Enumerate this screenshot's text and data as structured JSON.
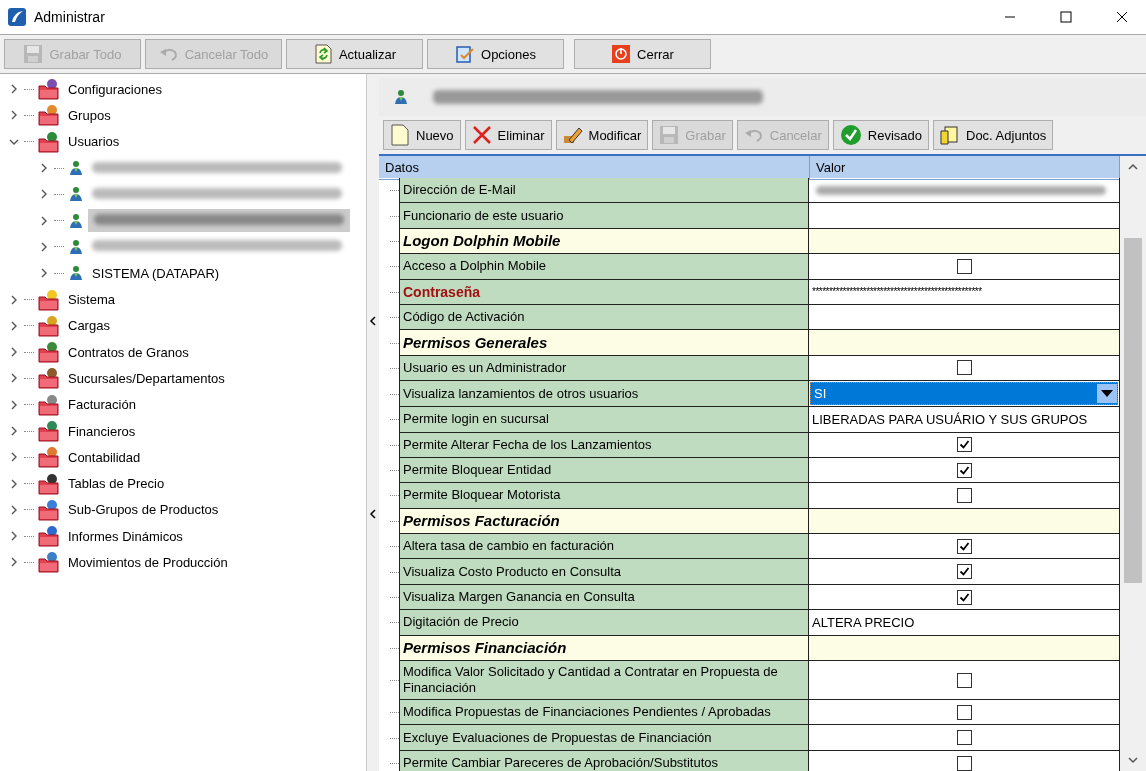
{
  "window": {
    "title": "Administrar"
  },
  "toolbar": [
    {
      "label": "Grabar Todo",
      "disabled": true
    },
    {
      "label": "Cancelar Todo",
      "disabled": true
    },
    {
      "label": "Actualizar",
      "disabled": false
    },
    {
      "label": "Opciones",
      "disabled": false
    },
    {
      "label": "Cerrar",
      "disabled": false
    }
  ],
  "tree": [
    {
      "label": "Configuraciones",
      "expanded": false,
      "selected": false
    },
    {
      "label": "Grupos",
      "expanded": false,
      "selected": false
    },
    {
      "label": "Usuarios",
      "expanded": true,
      "selected": false,
      "children": [
        {
          "kind": "blurred",
          "selected": false
        },
        {
          "kind": "blurred",
          "selected": false
        },
        {
          "kind": "blurred",
          "selected": true
        },
        {
          "kind": "blurred",
          "selected": false
        },
        {
          "kind": "user",
          "label": "SISTEMA (DATAPAR)",
          "selected": false
        }
      ]
    },
    {
      "label": "Sistema",
      "expanded": false,
      "selected": false
    },
    {
      "label": "Cargas",
      "expanded": false,
      "selected": false
    },
    {
      "label": "Contratos de Granos",
      "expanded": false,
      "selected": false
    },
    {
      "label": "Sucursales/Departamentos",
      "expanded": false,
      "selected": false
    },
    {
      "label": "Facturación",
      "expanded": false,
      "selected": false
    },
    {
      "label": "Financieros",
      "expanded": false,
      "selected": false
    },
    {
      "label": "Contabilidad",
      "expanded": false,
      "selected": false
    },
    {
      "label": "Tablas de Precio",
      "expanded": false,
      "selected": false
    },
    {
      "label": "Sub-Grupos de Productos",
      "expanded": false,
      "selected": false
    },
    {
      "label": "Informes Dinámicos",
      "expanded": false,
      "selected": false
    },
    {
      "label": "Movimientos de Producción",
      "expanded": false,
      "selected": false
    }
  ],
  "record_toolbar": [
    {
      "label": "Nuevo",
      "disabled": false
    },
    {
      "label": "Eliminar",
      "disabled": false
    },
    {
      "label": "Modificar",
      "disabled": false
    },
    {
      "label": "Grabar",
      "disabled": true
    },
    {
      "label": "Cancelar",
      "disabled": true
    },
    {
      "label": "Revisado",
      "disabled": false
    },
    {
      "label": "Doc. Adjuntos",
      "disabled": false
    }
  ],
  "grid": {
    "columns": [
      "Datos",
      "Valor"
    ],
    "rows": [
      {
        "kind": "blurred",
        "label": "Dirección de E-Mail"
      },
      {
        "kind": "text",
        "label": "Funcionario de este usuario"
      },
      {
        "kind": "section",
        "label": "Logon Dolphin Mobile"
      },
      {
        "kind": "checkbox",
        "label": "Acceso a Dolphin Mobile",
        "checked": false
      },
      {
        "kind": "password",
        "label": "Contraseña",
        "value": "**************************************************"
      },
      {
        "kind": "text",
        "label": "Código de Activación"
      },
      {
        "kind": "section",
        "label": "Permisos Generales"
      },
      {
        "kind": "checkbox",
        "label": "Usuario es un Administrador",
        "checked": false
      },
      {
        "kind": "dropdown",
        "label": "Visualiza lanzamientos de otros usuarios",
        "value": "SI"
      },
      {
        "kind": "text",
        "label": "Permite login en sucursal",
        "value": "LIBERADAS PARA USUÁRIO Y SUS GRUPOS"
      },
      {
        "kind": "checkbox",
        "label": "Permite Alterar Fecha de los Lanzamientos",
        "checked": true
      },
      {
        "kind": "checkbox",
        "label": "Permite Bloquear Entidad",
        "checked": true
      },
      {
        "kind": "checkbox",
        "label": "Permite Bloquear Motorista",
        "checked": false
      },
      {
        "kind": "section",
        "label": "Permisos Facturación"
      },
      {
        "kind": "checkbox",
        "label": "Altera tasa de cambio en facturación",
        "checked": true
      },
      {
        "kind": "checkbox",
        "label": "Visualiza Costo Producto en Consulta",
        "checked": true
      },
      {
        "kind": "checkbox",
        "label": "Visualiza Margen Ganancia en Consulta",
        "checked": true
      },
      {
        "kind": "text",
        "label": "Digitación de Precio",
        "value": "ALTERA PRECIO"
      },
      {
        "kind": "section",
        "label": "Permisos Financiación"
      },
      {
        "kind": "checkbox",
        "label": "Modifica Valor Solicitado y Cantidad a Contratar en Propuesta de Financiación",
        "checked": false
      },
      {
        "kind": "checkbox",
        "label": "Modifica Propuestas de Financiaciones Pendientes / Aprobadas",
        "checked": false
      },
      {
        "kind": "checkbox",
        "label": "Excluye Evaluaciones de Propuestas de Financiación",
        "checked": false
      },
      {
        "kind": "checkbox",
        "label": "Permite Cambiar Pareceres de Aprobación/Substitutos",
        "checked": false
      }
    ]
  }
}
